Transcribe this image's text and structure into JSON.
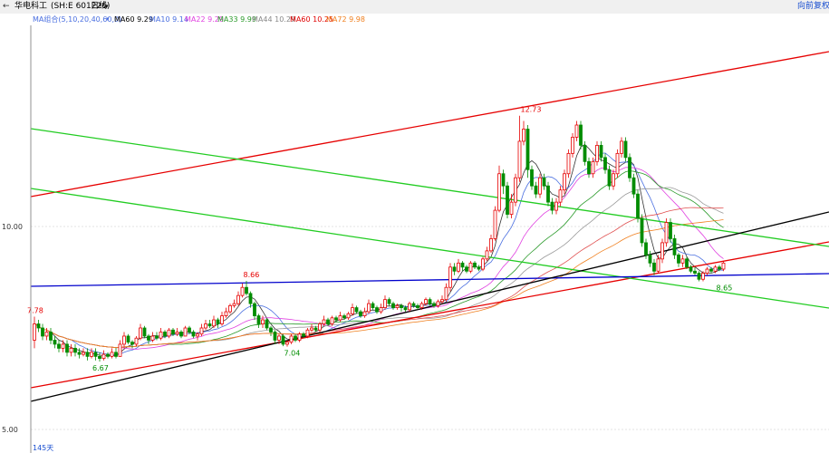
{
  "window": {
    "back_icon": "back-arrow-icon",
    "stock_name": "华电科工",
    "code_text": "(SH:E 601226)",
    "period": "日线",
    "period_icon": "chevron-down-icon",
    "right_link": "向前复权"
  },
  "legend": {
    "label": "MA组合(5,10,20,40,60,0)",
    "icon": "chevron-down-icon",
    "items": [
      {
        "text": "MA60 9.29",
        "color": "#000000"
      },
      {
        "text": "MA10 9.14",
        "color": "#4a6fe0"
      },
      {
        "text": "MA22 9.29",
        "color": "#e040e0"
      },
      {
        "text": "MA33 9.99",
        "color": "#2a9a2a"
      },
      {
        "text": "MA44 10.29",
        "color": "#888888"
      },
      {
        "text": "MA60 10.25",
        "color": "#e00000"
      },
      {
        "text": "MA72 9.98",
        "color": "#f08020"
      }
    ]
  },
  "footer": {
    "bar_count": "145天"
  },
  "colors": {
    "up": "#e60000",
    "down": "#008c00",
    "grid": "#c8c8c8"
  },
  "chart_data": {
    "type": "candlestick",
    "y_ticks": [
      5.0,
      10.0
    ],
    "y_tick_labels": [
      "5.00",
      "10.00"
    ],
    "annotations": [
      {
        "text": "7.78",
        "bar": 0,
        "price": 7.78,
        "color": "#e60000"
      },
      {
        "text": "6.67",
        "bar": 16,
        "price": 6.67,
        "color": "#008c00"
      },
      {
        "text": "8.66",
        "bar": 53,
        "price": 8.66,
        "color": "#e60000"
      },
      {
        "text": "7.04",
        "bar": 63,
        "price": 7.04,
        "color": "#008c00"
      },
      {
        "text": "12.73",
        "bar": 121,
        "price": 12.73,
        "color": "#e60000"
      },
      {
        "text": "8.65",
        "bar": 169,
        "price": 8.65,
        "color": "#008c00"
      }
    ],
    "candles": [
      [
        7.2,
        7.6,
        7.0,
        7.78
      ],
      [
        7.6,
        7.5,
        7.4,
        7.7
      ],
      [
        7.5,
        7.3,
        7.2,
        7.6
      ],
      [
        7.3,
        7.4,
        7.2,
        7.5
      ],
      [
        7.4,
        7.2,
        7.1,
        7.5
      ],
      [
        7.2,
        7.1,
        7.0,
        7.3
      ],
      [
        7.1,
        7.0,
        6.9,
        7.2
      ],
      [
        7.0,
        7.1,
        6.9,
        7.2
      ],
      [
        7.1,
        6.9,
        6.8,
        7.2
      ],
      [
        6.9,
        7.0,
        6.8,
        7.1
      ],
      [
        7.0,
        6.9,
        6.8,
        7.1
      ],
      [
        6.9,
        6.85,
        6.75,
        7.0
      ],
      [
        6.85,
        6.9,
        6.8,
        7.0
      ],
      [
        6.9,
        6.8,
        6.7,
        7.0
      ],
      [
        6.8,
        6.9,
        6.75,
        7.0
      ],
      [
        6.9,
        6.8,
        6.7,
        7.0
      ],
      [
        6.8,
        6.75,
        6.67,
        6.9
      ],
      [
        6.75,
        6.85,
        6.7,
        6.95
      ],
      [
        6.85,
        6.8,
        6.75,
        6.9
      ],
      [
        6.8,
        6.9,
        6.75,
        7.0
      ],
      [
        6.9,
        6.8,
        6.75,
        7.0
      ],
      [
        6.8,
        7.1,
        6.8,
        7.2
      ],
      [
        7.1,
        7.3,
        7.0,
        7.4
      ],
      [
        7.3,
        7.15,
        7.1,
        7.35
      ],
      [
        7.15,
        7.1,
        7.0,
        7.2
      ],
      [
        7.1,
        7.25,
        7.05,
        7.3
      ],
      [
        7.25,
        7.5,
        7.2,
        7.6
      ],
      [
        7.5,
        7.3,
        7.25,
        7.55
      ],
      [
        7.3,
        7.2,
        7.1,
        7.35
      ],
      [
        7.2,
        7.3,
        7.15,
        7.4
      ],
      [
        7.3,
        7.25,
        7.2,
        7.4
      ],
      [
        7.25,
        7.4,
        7.2,
        7.5
      ],
      [
        7.4,
        7.3,
        7.25,
        7.45
      ],
      [
        7.3,
        7.45,
        7.25,
        7.5
      ],
      [
        7.45,
        7.35,
        7.3,
        7.5
      ],
      [
        7.35,
        7.4,
        7.3,
        7.5
      ],
      [
        7.4,
        7.3,
        7.25,
        7.45
      ],
      [
        7.3,
        7.5,
        7.3,
        7.55
      ],
      [
        7.5,
        7.4,
        7.35,
        7.55
      ],
      [
        7.4,
        7.3,
        7.25,
        7.45
      ],
      [
        7.3,
        7.35,
        7.2,
        7.4
      ],
      [
        7.35,
        7.5,
        7.3,
        7.6
      ],
      [
        7.5,
        7.6,
        7.45,
        7.7
      ],
      [
        7.6,
        7.55,
        7.5,
        7.7
      ],
      [
        7.55,
        7.7,
        7.5,
        7.8
      ],
      [
        7.7,
        7.6,
        7.5,
        7.75
      ],
      [
        7.6,
        7.8,
        7.55,
        7.9
      ],
      [
        7.8,
        7.9,
        7.75,
        8.0
      ],
      [
        7.9,
        8.05,
        7.85,
        8.1
      ],
      [
        8.05,
        8.1,
        8.0,
        8.2
      ],
      [
        8.1,
        8.3,
        8.05,
        8.4
      ],
      [
        8.3,
        8.5,
        8.25,
        8.6
      ],
      [
        8.5,
        8.35,
        8.3,
        8.66
      ],
      [
        8.35,
        8.1,
        8.0,
        8.4
      ],
      [
        8.1,
        7.8,
        7.7,
        8.15
      ],
      [
        7.8,
        7.6,
        7.5,
        7.85
      ],
      [
        7.6,
        7.7,
        7.5,
        7.8
      ],
      [
        7.7,
        7.5,
        7.45,
        7.75
      ],
      [
        7.5,
        7.4,
        7.3,
        7.55
      ],
      [
        7.4,
        7.2,
        7.1,
        7.45
      ],
      [
        7.2,
        7.3,
        7.1,
        7.35
      ],
      [
        7.3,
        7.1,
        7.05,
        7.35
      ],
      [
        7.1,
        7.15,
        7.04,
        7.2
      ],
      [
        7.15,
        7.3,
        7.1,
        7.35
      ],
      [
        7.3,
        7.2,
        7.15,
        7.35
      ],
      [
        7.2,
        7.35,
        7.15,
        7.4
      ],
      [
        7.35,
        7.3,
        7.25,
        7.4
      ],
      [
        7.3,
        7.45,
        7.25,
        7.5
      ],
      [
        7.45,
        7.5,
        7.4,
        7.6
      ],
      [
        7.5,
        7.45,
        7.4,
        7.55
      ],
      [
        7.45,
        7.6,
        7.4,
        7.65
      ],
      [
        7.6,
        7.7,
        7.55,
        7.8
      ],
      [
        7.7,
        7.6,
        7.55,
        7.75
      ],
      [
        7.6,
        7.75,
        7.55,
        7.8
      ],
      [
        7.75,
        7.7,
        7.65,
        7.8
      ],
      [
        7.7,
        7.8,
        7.65,
        7.9
      ],
      [
        7.8,
        7.75,
        7.7,
        7.85
      ],
      [
        7.75,
        7.85,
        7.7,
        7.9
      ],
      [
        7.85,
        8.0,
        7.8,
        8.1
      ],
      [
        8.0,
        7.9,
        7.85,
        8.05
      ],
      [
        7.9,
        7.8,
        7.75,
        7.95
      ],
      [
        7.8,
        7.9,
        7.75,
        8.0
      ],
      [
        7.9,
        8.1,
        7.85,
        8.2
      ],
      [
        8.1,
        8.0,
        7.95,
        8.15
      ],
      [
        8.0,
        7.9,
        7.85,
        8.05
      ],
      [
        7.9,
        8.0,
        7.85,
        8.1
      ],
      [
        8.0,
        8.2,
        7.95,
        8.3
      ],
      [
        8.2,
        8.1,
        8.05,
        8.25
      ],
      [
        8.1,
        8.0,
        7.95,
        8.15
      ],
      [
        8.0,
        8.05,
        7.95,
        8.1
      ],
      [
        8.05,
        8.0,
        7.9,
        8.1
      ],
      [
        8.0,
        7.95,
        7.9,
        8.05
      ],
      [
        7.95,
        8.1,
        7.9,
        8.15
      ],
      [
        8.1,
        8.05,
        8.0,
        8.15
      ],
      [
        8.05,
        8.0,
        7.95,
        8.1
      ],
      [
        8.0,
        8.1,
        7.95,
        8.15
      ],
      [
        8.1,
        8.2,
        8.05,
        8.25
      ],
      [
        8.2,
        8.1,
        8.05,
        8.25
      ],
      [
        8.1,
        8.05,
        8.0,
        8.15
      ],
      [
        8.05,
        8.15,
        8.0,
        8.2
      ],
      [
        8.15,
        8.2,
        8.1,
        8.3
      ],
      [
        8.2,
        8.5,
        8.15,
        8.6
      ],
      [
        8.5,
        9.0,
        8.4,
        9.1
      ],
      [
        9.0,
        8.9,
        8.8,
        9.1
      ],
      [
        8.9,
        9.1,
        8.85,
        9.2
      ],
      [
        9.1,
        9.0,
        8.9,
        9.15
      ],
      [
        9.0,
        8.9,
        8.85,
        9.05
      ],
      [
        8.9,
        9.1,
        8.85,
        9.15
      ],
      [
        9.1,
        9.0,
        8.95,
        9.15
      ],
      [
        9.0,
        8.95,
        8.9,
        9.05
      ],
      [
        8.95,
        9.2,
        8.9,
        9.25
      ],
      [
        9.2,
        9.4,
        9.15,
        9.5
      ],
      [
        9.4,
        9.7,
        9.35,
        9.8
      ],
      [
        9.7,
        10.4,
        9.65,
        10.5
      ],
      [
        10.4,
        11.3,
        10.35,
        11.5
      ],
      [
        11.3,
        11.0,
        10.8,
        11.4
      ],
      [
        11.0,
        10.3,
        10.2,
        11.1
      ],
      [
        10.3,
        10.6,
        10.2,
        10.8
      ],
      [
        10.6,
        11.2,
        10.5,
        11.3
      ],
      [
        11.2,
        12.1,
        11.1,
        12.73
      ],
      [
        12.1,
        12.4,
        12.0,
        12.6
      ],
      [
        12.4,
        11.4,
        11.2,
        12.5
      ],
      [
        11.4,
        11.0,
        10.9,
        11.5
      ],
      [
        11.0,
        10.8,
        10.7,
        11.1
      ],
      [
        10.8,
        11.2,
        10.7,
        11.3
      ],
      [
        11.2,
        11.0,
        10.9,
        11.3
      ],
      [
        11.0,
        10.6,
        10.5,
        11.1
      ],
      [
        10.6,
        10.4,
        10.3,
        10.7
      ],
      [
        10.4,
        10.6,
        10.3,
        10.7
      ],
      [
        10.6,
        10.9,
        10.5,
        11.0
      ],
      [
        10.9,
        11.3,
        10.8,
        11.4
      ],
      [
        11.3,
        11.8,
        11.2,
        11.9
      ],
      [
        11.8,
        12.2,
        11.7,
        12.3
      ],
      [
        12.2,
        12.5,
        12.1,
        12.6
      ],
      [
        12.5,
        12.0,
        11.9,
        12.6
      ],
      [
        12.0,
        11.6,
        11.5,
        12.1
      ],
      [
        11.6,
        11.3,
        11.2,
        11.7
      ],
      [
        11.3,
        11.6,
        11.2,
        11.7
      ],
      [
        11.6,
        12.0,
        11.5,
        12.1
      ],
      [
        12.0,
        11.7,
        11.6,
        12.1
      ],
      [
        11.7,
        11.4,
        11.3,
        11.8
      ],
      [
        11.4,
        11.0,
        10.9,
        11.5
      ],
      [
        11.0,
        11.3,
        10.9,
        11.4
      ],
      [
        11.3,
        11.8,
        11.2,
        11.9
      ],
      [
        11.8,
        12.1,
        11.7,
        12.2
      ],
      [
        12.1,
        11.7,
        11.6,
        12.2
      ],
      [
        11.7,
        11.2,
        11.1,
        11.8
      ],
      [
        11.2,
        10.8,
        10.7,
        11.3
      ],
      [
        10.8,
        10.2,
        10.1,
        10.9
      ],
      [
        10.2,
        9.6,
        9.5,
        10.3
      ],
      [
        9.6,
        9.3,
        9.2,
        9.7
      ],
      [
        9.3,
        9.1,
        9.0,
        9.4
      ],
      [
        9.1,
        8.9,
        8.8,
        9.2
      ],
      [
        8.9,
        9.2,
        8.85,
        9.3
      ],
      [
        9.2,
        9.6,
        9.1,
        9.7
      ],
      [
        9.6,
        10.1,
        9.5,
        10.2
      ],
      [
        10.1,
        9.7,
        9.6,
        10.2
      ],
      [
        9.7,
        9.3,
        9.2,
        9.8
      ],
      [
        9.3,
        9.1,
        9.0,
        9.35
      ],
      [
        9.1,
        9.2,
        9.0,
        9.3
      ],
      [
        9.2,
        9.0,
        8.95,
        9.25
      ],
      [
        9.0,
        8.9,
        8.85,
        9.05
      ],
      [
        8.9,
        8.85,
        8.8,
        9.0
      ],
      [
        8.85,
        8.7,
        8.65,
        8.9
      ],
      [
        8.7,
        8.85,
        8.65,
        8.9
      ],
      [
        8.85,
        8.95,
        8.8,
        9.0
      ],
      [
        8.95,
        8.9,
        8.85,
        9.0
      ],
      [
        8.9,
        9.0,
        8.85,
        9.05
      ],
      [
        9.0,
        8.95,
        8.9,
        9.05
      ],
      [
        8.95,
        9.1,
        8.9,
        9.15
      ]
    ]
  }
}
